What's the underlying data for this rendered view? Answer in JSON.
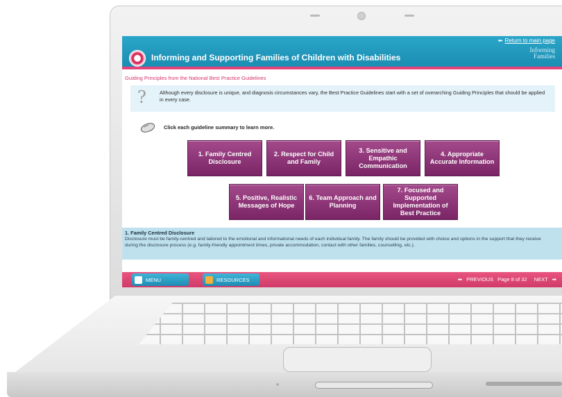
{
  "header": {
    "return_link": "Return to main page",
    "title": "Informing and Supporting Families of Children with Disabilities",
    "brand_line1": "Informing",
    "brand_line2": "Families"
  },
  "page": {
    "subtitle": "Guiding Principles from the National Best Practice Guidelines",
    "intro": "Although every disclosure is unique, and diagnosis circumstances vary, the Best Practice Guidelines start with a set of overarching Guiding Principles that should be applied in every case.",
    "instruction": "Click each guideline summary to learn more."
  },
  "guidelines": [
    {
      "label": "1. Family Centred Disclosure"
    },
    {
      "label": "2. Respect for Child and Family"
    },
    {
      "label": "3. Sensitive and Empathic Communication"
    },
    {
      "label": "4. Appropriate Accurate Information"
    },
    {
      "label": "5. Positive, Realistic Messages of Hope"
    },
    {
      "label": "6. Team Approach and Planning"
    },
    {
      "label": "7. Focused and Supported Implementation of Best Practice"
    }
  ],
  "detail": {
    "title": "1. Family Centred Disclosure",
    "text": "Disclosure must be family-centred and tailored to the emotional and informational needs of each individual family. The family should be provided with choice and options in the support that they receive during the disclosure process (e.g. family-friendly appointment times, private accommodation, contact with other families, counselling, etc.)."
  },
  "footer": {
    "menu_label": "MENU",
    "resources_label": "RESOURCES",
    "previous_label": "PREVIOUS",
    "page_indicator": "Page 8 of 32",
    "next_label": "NEXT"
  },
  "colors": {
    "header_blue": "#1b8db2",
    "accent_pink": "#e3437a",
    "button_purple": "#7a2466",
    "detail_blue": "#bfe1ee"
  }
}
